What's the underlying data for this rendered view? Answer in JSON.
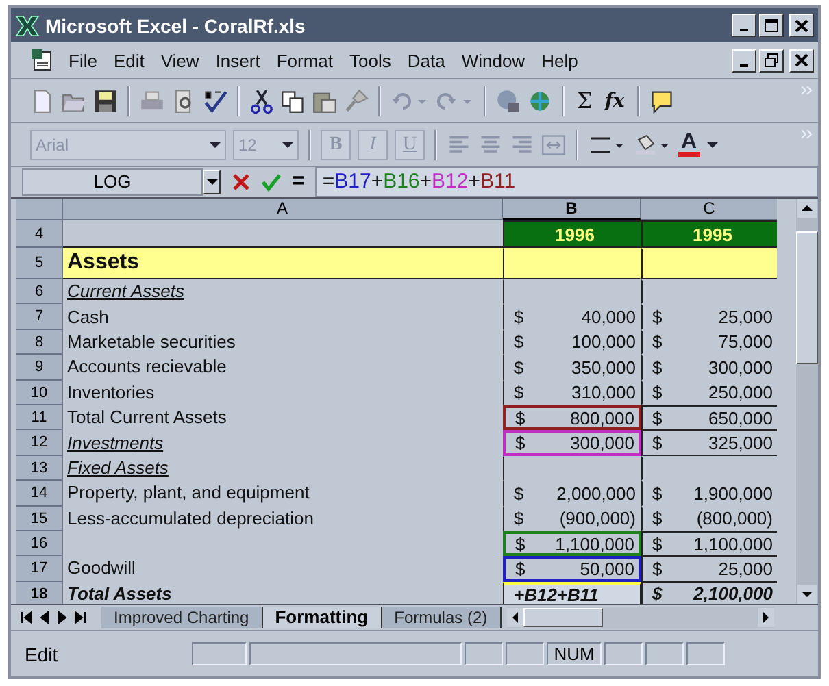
{
  "window": {
    "title": "Microsoft Excel - CoralRf.xls"
  },
  "menu": [
    "File",
    "Edit",
    "View",
    "Insert",
    "Format",
    "Tools",
    "Data",
    "Window",
    "Help"
  ],
  "standard_toolbar": {
    "sum": "Σ",
    "function": "fx"
  },
  "formatting_toolbar": {
    "font": "Arial",
    "size": "12",
    "bold": "B",
    "italic": "I",
    "underline": "U",
    "font_color": "A",
    "disabled": true
  },
  "formula_bar": {
    "name_box": "LOG",
    "equals": "=",
    "parts": [
      {
        "text": "=",
        "color": "#1a1a1a"
      },
      {
        "text": "B17",
        "color": "#2020c0"
      },
      {
        "text": "+",
        "color": "#1a1a1a"
      },
      {
        "text": "B16",
        "color": "#208020"
      },
      {
        "text": "+",
        "color": "#1a1a1a"
      },
      {
        "text": "B12",
        "color": "#c030c0"
      },
      {
        "text": "+",
        "color": "#1a1a1a"
      },
      {
        "text": "B11",
        "color": "#902020"
      }
    ]
  },
  "columns": [
    {
      "label": "A",
      "selected": false
    },
    {
      "label": "B",
      "selected": true
    },
    {
      "label": "C",
      "selected": false
    }
  ],
  "rows": [
    {
      "num": "4",
      "kind": "year",
      "selected": false,
      "boxed": false,
      "b": {
        "amount": "1996"
      },
      "c": {
        "amount": "1995"
      }
    },
    {
      "num": "5",
      "kind": "section",
      "selected": false,
      "boxed": false,
      "a": "Assets"
    },
    {
      "num": "6",
      "kind": "subhead",
      "selected": false,
      "boxed": false,
      "a": "Current Assets"
    },
    {
      "num": "7",
      "kind": "item",
      "selected": false,
      "boxed": false,
      "a": "Cash",
      "b": {
        "dollar": "$",
        "amount": "40,000"
      },
      "c": {
        "dollar": "$",
        "amount": "25,000"
      }
    },
    {
      "num": "8",
      "kind": "item",
      "selected": false,
      "boxed": false,
      "a": "Marketable securities",
      "b": {
        "dollar": "$",
        "amount": "100,000"
      },
      "c": {
        "dollar": "$",
        "amount": "75,000"
      }
    },
    {
      "num": "9",
      "kind": "item",
      "selected": false,
      "boxed": false,
      "a": "Accounts recievable",
      "b": {
        "dollar": "$",
        "amount": "350,000"
      },
      "c": {
        "dollar": "$",
        "amount": "300,000"
      }
    },
    {
      "num": "10",
      "kind": "item",
      "selected": false,
      "boxed": false,
      "a": "Inventories",
      "b": {
        "dollar": "$",
        "amount": "310,000"
      },
      "c": {
        "dollar": "$",
        "amount": "250,000"
      }
    },
    {
      "num": "11",
      "kind": "item",
      "selected": false,
      "boxed": true,
      "a": "Total Current Assets",
      "b": {
        "dollar": "$",
        "amount": "800,000",
        "color": "#902020"
      },
      "c": {
        "dollar": "$",
        "amount": "650,000"
      }
    },
    {
      "num": "12",
      "kind": "subhead",
      "selected": false,
      "boxed": true,
      "a": "Investments",
      "b": {
        "dollar": "$",
        "amount": "300,000",
        "color": "#c030c0"
      },
      "c": {
        "dollar": "$",
        "amount": "325,000"
      }
    },
    {
      "num": "13",
      "kind": "subhead",
      "selected": false,
      "boxed": false,
      "a": "Fixed Assets"
    },
    {
      "num": "14",
      "kind": "item",
      "selected": false,
      "boxed": false,
      "a": "Property, plant, and equipment",
      "b": {
        "dollar": "$",
        "amount": "2,000,000"
      },
      "c": {
        "dollar": "$",
        "amount": "1,900,000"
      }
    },
    {
      "num": "15",
      "kind": "item",
      "selected": false,
      "boxed": false,
      "a": "Less-accumulated depreciation",
      "b": {
        "dollar": "$",
        "amount": "(900,000)"
      },
      "c": {
        "dollar": "$",
        "amount": "(800,000)"
      }
    },
    {
      "num": "16",
      "kind": "item",
      "selected": false,
      "boxed": true,
      "b": {
        "dollar": "$",
        "amount": "1,100,000",
        "color": "#208020"
      },
      "c": {
        "dollar": "$",
        "amount": "1,100,000"
      }
    },
    {
      "num": "17",
      "kind": "item",
      "selected": false,
      "boxed": true,
      "a": "Goodwill",
      "b": {
        "dollar": "$",
        "amount": "50,000",
        "color": "#2020c0"
      },
      "c": {
        "dollar": "$",
        "amount": "25,000"
      }
    },
    {
      "num": "18",
      "kind": "total",
      "selected": true,
      "boxed": true,
      "a": "Total Assets",
      "b": {
        "text": "+B12+B11",
        "editing": true
      },
      "c": {
        "dollar": "$",
        "amount": "2,100,000"
      }
    }
  ],
  "sheet_tabs": [
    {
      "label": "Improved Charting",
      "selected": false
    },
    {
      "label": "Formatting",
      "selected": true
    },
    {
      "label": "Formulas (2)",
      "selected": false
    }
  ],
  "status_bar": {
    "mode": "Edit",
    "num": "NUM"
  }
}
